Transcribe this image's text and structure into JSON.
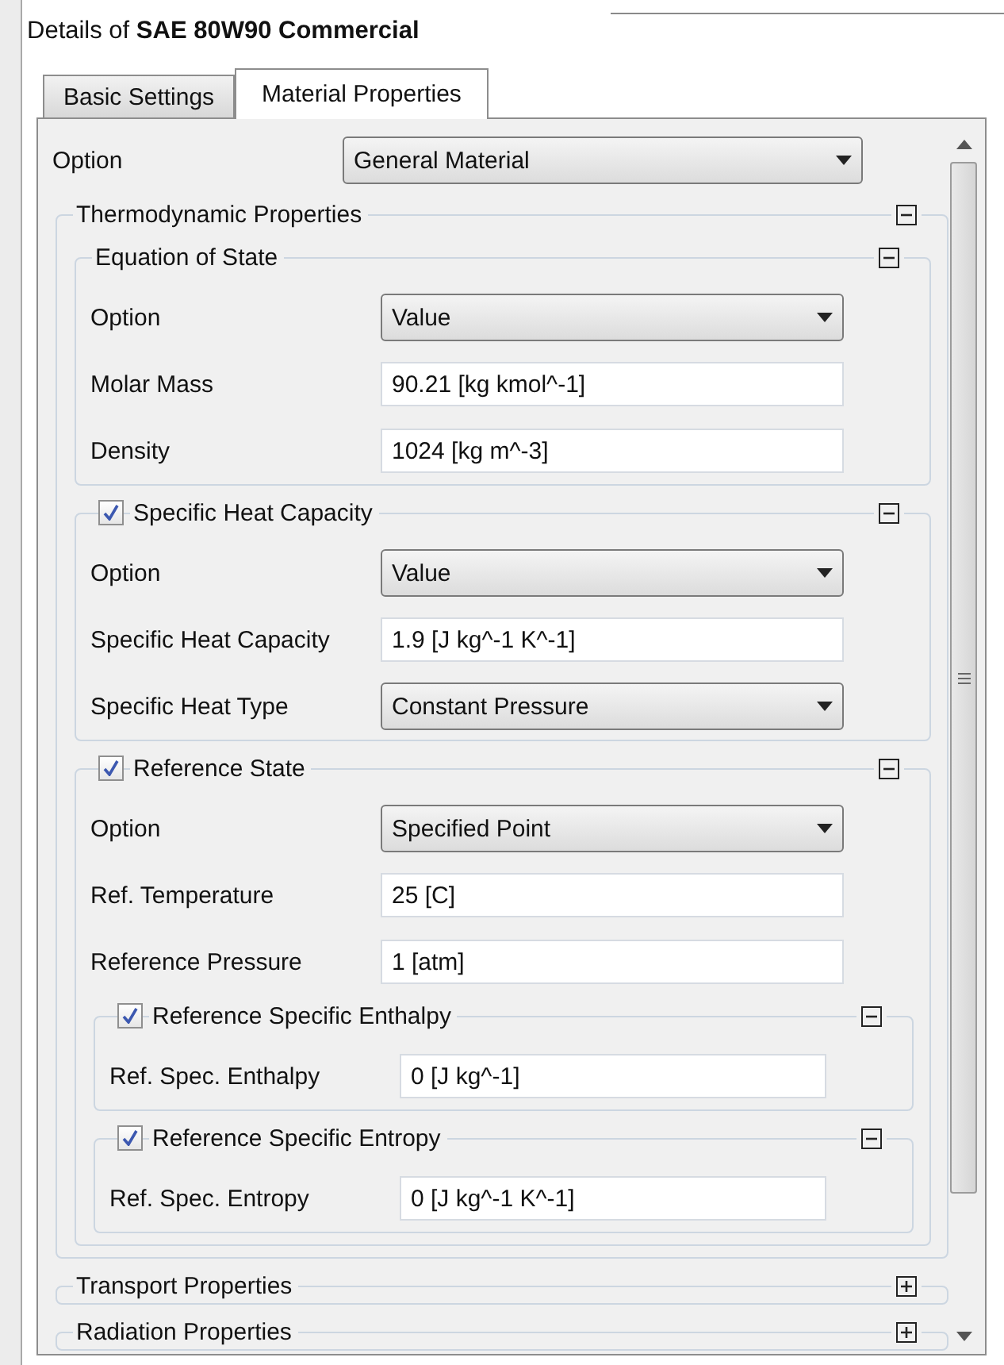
{
  "title": "Details of **SAE 80W90 Commercial**",
  "tabs": [
    {
      "label": "Basic Settings",
      "selected": false
    },
    {
      "label": "Material Properties",
      "selected": true
    }
  ],
  "option": {
    "kind": "dropdown",
    "label": "Option",
    "value": "General Material"
  },
  "groups": [
    {
      "title": "Thermodynamic Properties",
      "expanded": true,
      "children": [
        {
          "title": "Equation of State",
          "expanded": true,
          "rows": [
            {
              "kind": "dropdown",
              "label": "Option",
              "value": "Value"
            },
            {
              "kind": "field",
              "label": "Molar Mass",
              "value": "90.21 [kg kmol^-1]"
            },
            {
              "kind": "field",
              "label": "Density",
              "value": "1024 [kg m^-3]"
            }
          ]
        },
        {
          "title": "Specific Heat Capacity",
          "checked": true,
          "expanded": true,
          "rows": [
            {
              "kind": "dropdown",
              "label": "Option",
              "value": "Value"
            },
            {
              "kind": "field",
              "label": "Specific Heat Capacity",
              "value": "1.9 [J kg^-1 K^-1]"
            },
            {
              "kind": "dropdown",
              "label": "Specific Heat Type",
              "value": "Constant Pressure"
            }
          ]
        },
        {
          "title": "Reference State",
          "checked": true,
          "expanded": true,
          "rows": [
            {
              "kind": "dropdown",
              "label": "Option",
              "value": "Specified Point"
            },
            {
              "kind": "field",
              "label": "Ref. Temperature",
              "value": "25 [C]"
            },
            {
              "kind": "field",
              "label": "Reference Pressure",
              "value": "1 [atm]"
            }
          ],
          "children": [
            {
              "title": "Reference Specific Enthalpy",
              "checked": true,
              "expanded": true,
              "rows": [
                {
                  "kind": "field",
                  "label": "Ref. Spec. Enthalpy",
                  "value": "0 [J kg^-1]"
                }
              ]
            },
            {
              "title": "Reference Specific Entropy",
              "checked": true,
              "expanded": true,
              "rows": [
                {
                  "kind": "field",
                  "label": "Ref. Spec. Entropy",
                  "value": "0 [J kg^-1 K^-1]"
                }
              ]
            }
          ]
        }
      ]
    },
    {
      "title": "Transport Properties",
      "expanded": false
    },
    {
      "title": "Radiation Properties",
      "expanded": false
    }
  ]
}
